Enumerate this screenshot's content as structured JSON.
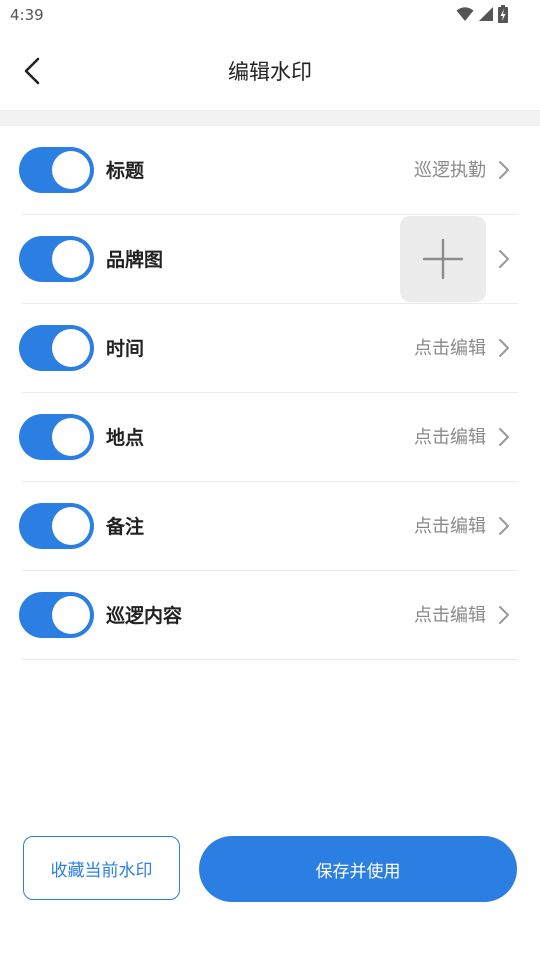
{
  "status_bar": {
    "time": "4:39",
    "icons": [
      "wifi-icon",
      "signal-icon",
      "battery-charging-icon"
    ]
  },
  "header": {
    "title": "编辑水印",
    "back_icon": "chevron-left-icon"
  },
  "colors": {
    "accent": "#2b7fe3",
    "secondary_text": "#8a8a8a",
    "divider": "#ececec",
    "section_bg": "#f2f2f2"
  },
  "items": [
    {
      "label": "标题",
      "value": "巡逻执勤",
      "enabled": true
    },
    {
      "label": "品牌图",
      "value": "",
      "enabled": true,
      "thumbnail_icon": "plus-icon"
    },
    {
      "label": "时间",
      "value": "点击编辑",
      "enabled": true
    },
    {
      "label": "地点",
      "value": "点击编辑",
      "enabled": true
    },
    {
      "label": "备注",
      "value": "点击编辑",
      "enabled": true
    },
    {
      "label": "巡逻内容",
      "value": "点击编辑",
      "enabled": true
    }
  ],
  "footer": {
    "favorite_label": "收藏当前水印",
    "save_label": "保存并使用"
  }
}
